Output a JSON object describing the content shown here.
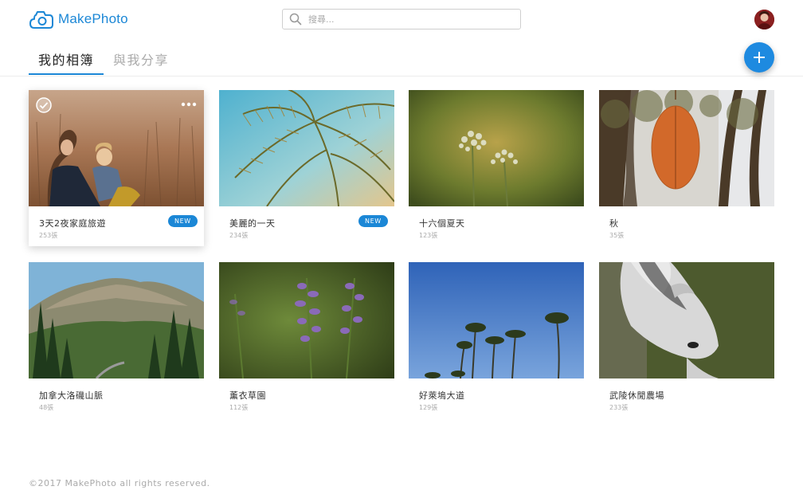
{
  "app": {
    "name": "MakePhoto",
    "logo_icon": "camera-cloud-icon",
    "accent": "#1b87d6"
  },
  "search": {
    "placeholder": "搜尋..."
  },
  "tabs": [
    {
      "label": "我的相簿",
      "active": true
    },
    {
      "label": "與我分享",
      "active": false
    }
  ],
  "fab": {
    "icon": "plus-icon"
  },
  "albums": [
    {
      "title": "3天2夜家庭旅遊",
      "count": "253張",
      "badge": "NEW",
      "selected": true
    },
    {
      "title": "美麗的一天",
      "count": "234張",
      "badge": "NEW"
    },
    {
      "title": "十六個夏天",
      "count": "123張"
    },
    {
      "title": "秋",
      "count": "35張"
    },
    {
      "title": "加拿大洛磯山脈",
      "count": "48張"
    },
    {
      "title": "薰衣草園",
      "count": "112張"
    },
    {
      "title": "好萊塢大道",
      "count": "129張"
    },
    {
      "title": "武陵休閒農場",
      "count": "233張"
    }
  ],
  "footer": {
    "text": "©2017 MakePhoto all rights reserved."
  }
}
